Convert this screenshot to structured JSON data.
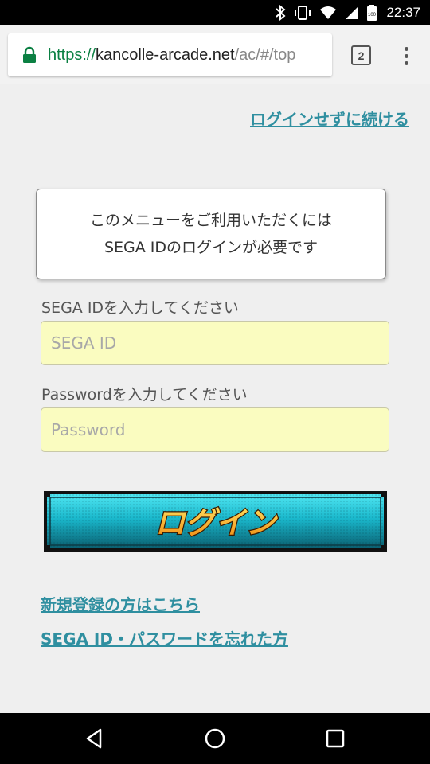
{
  "status_bar": {
    "time": "22:37",
    "battery_level": "100",
    "icons": [
      "bluetooth-icon",
      "vibrate-icon",
      "wifi-icon",
      "cell-signal-icon",
      "battery-icon"
    ]
  },
  "browser": {
    "url_scheme": "https://",
    "url_host": "kancolle-arcade.net",
    "url_path": "/ac/#/top",
    "tab_count": "2"
  },
  "page": {
    "skip_login_link": "ログインせずに続ける",
    "notice_line1": "このメニューをご利用いただくには",
    "notice_line2": "SEGA IDのログインが必要です",
    "sega_id_label": "SEGA IDを入力してください",
    "sega_id_placeholder": "SEGA ID",
    "password_label": "Passwordを入力してください",
    "password_placeholder": "Password",
    "login_button_label": "ログイン",
    "register_link": "新規登録の方はこちら",
    "forgot_link": "SEGA ID・パスワードを忘れた方"
  },
  "colors": {
    "link": "#2f8fa0",
    "input_bg": "#fafcc0",
    "button_teal": "#1ab8cc",
    "button_text": "#f5a020",
    "url_scheme_green": "#0b8043"
  }
}
